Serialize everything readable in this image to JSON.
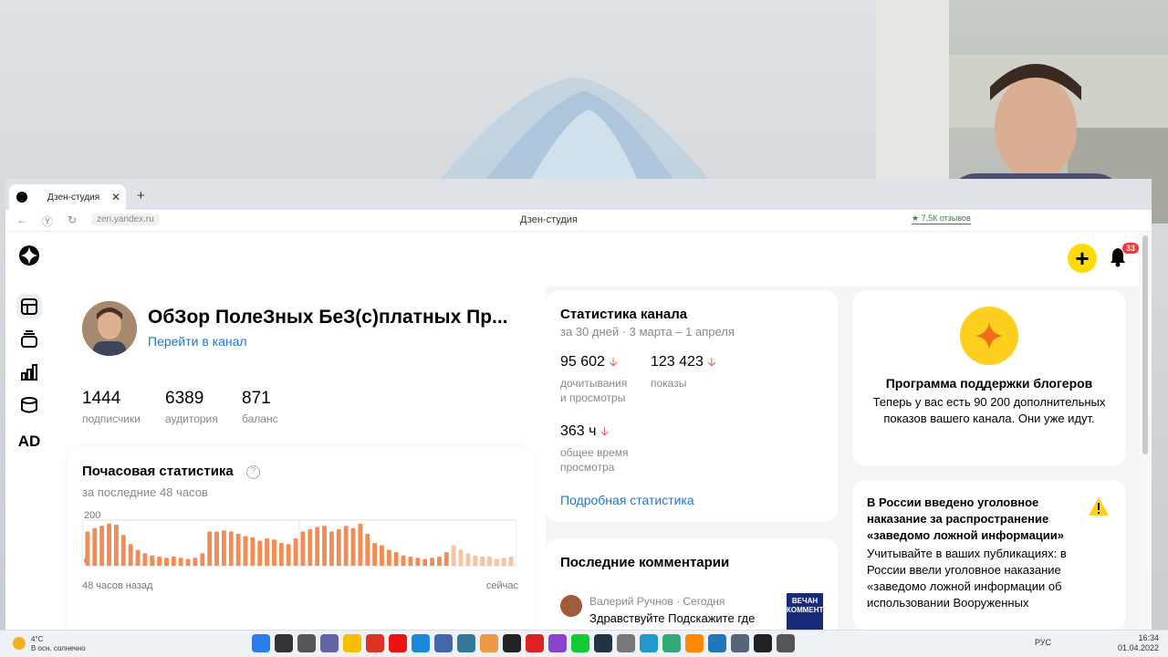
{
  "browser": {
    "tab_title": "Дзен-студия",
    "url": "zen.yandex.ru",
    "page_title": "Дзен-студия",
    "reviews_badge": "★ 7,5К отзывов"
  },
  "header": {
    "notifications_count": "33"
  },
  "left_nav": {
    "ad_label": "AD"
  },
  "channel": {
    "title": "ОбЗор ПолеЗных БеЗ(с)платных Пр...",
    "link": "Перейти в канал",
    "stats": [
      {
        "value": "1444",
        "label": "подписчики"
      },
      {
        "value": "6389",
        "label": "аудитория"
      },
      {
        "value": "871",
        "label": "баланс"
      }
    ]
  },
  "hourly": {
    "title": "Почасовая статистика",
    "help": "?",
    "subtitle": "за последние 48 часов",
    "xlabel_left": "48 часов назад",
    "xlabel_right": "сейчас"
  },
  "chart_data": {
    "type": "bar",
    "title": "Почасовая статистика",
    "ytick_labels": [
      "200",
      "0"
    ],
    "ylim": [
      0,
      200
    ],
    "x_start_label": "48 часов назад",
    "x_end_label": "сейчас",
    "values": [
      150,
      165,
      175,
      185,
      180,
      135,
      95,
      70,
      55,
      45,
      40,
      35,
      40,
      35,
      30,
      35,
      55,
      150,
      150,
      155,
      150,
      140,
      130,
      125,
      110,
      120,
      115,
      100,
      95,
      120,
      150,
      160,
      170,
      175,
      150,
      160,
      175,
      165,
      185,
      140,
      100,
      90,
      70,
      60,
      45,
      40,
      35,
      30,
      35,
      40,
      60,
      90,
      70,
      55,
      45,
      40,
      40,
      30,
      35,
      40
    ],
    "highlight_from_index": 51,
    "colors": {
      "bar": "#f28c55",
      "bar_faded": "#f7c3a3"
    }
  },
  "channel_stats": {
    "title": "Статистика канала",
    "period": "за 30 дней · 3 марта – 1 апреля",
    "metrics": [
      {
        "value": "95 602",
        "label_line1": "дочитывания",
        "label_line2": "и просмотры"
      },
      {
        "value": "123 423",
        "label_line1": "показы",
        "label_line2": ""
      },
      {
        "value": "363 ч",
        "label_line1": "общее время",
        "label_line2": "просмотра"
      }
    ],
    "trend_icon": "arrow-down-icon",
    "link": "Подробная статистика"
  },
  "comments": {
    "title": "Последние комментарии",
    "author": "Валерий Ручнов · Сегодня",
    "text": "Здравствуйте Подскажите где",
    "thumb_text": "ВЕЧАН КОММЕНТАР"
  },
  "program": {
    "title": "Программа поддержки блогеров",
    "text": "Теперь у вас есть 90 200 дополнительных показов вашего канала. Они уже идут."
  },
  "warning": {
    "title": "В России введено уголовное наказание за распространение «заведомо ложной информации»",
    "text": "Учитывайте в ваших публикациях: в России ввели уголовное наказание «заведомо ложной информации об использовании Вооруженных"
  },
  "taskbar": {
    "temperature": "4°C",
    "weather": "В осн. солнечно",
    "language": "РУС",
    "time": "16:34",
    "date": "01.04.2022"
  }
}
